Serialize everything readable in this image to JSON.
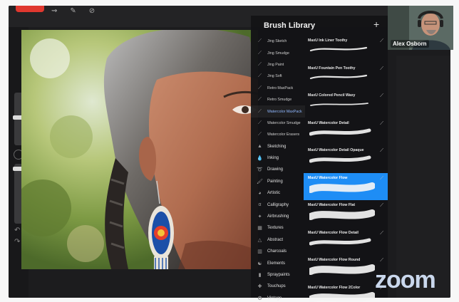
{
  "meeting": {
    "participant_name": "Alex Osborn",
    "brand": "zoom"
  },
  "app": {
    "top_tools": [
      "⇝",
      "✎",
      "⊘"
    ]
  },
  "panel": {
    "title": "Brush Library",
    "add_icon": "+",
    "sets": [
      {
        "label": "Jing Sketch",
        "icon": "brush-stroke-icon",
        "kind": "sub"
      },
      {
        "label": "Jing Smudge",
        "icon": "brush-stroke-icon",
        "kind": "sub"
      },
      {
        "label": "Jing Paint",
        "icon": "brush-stroke-icon",
        "kind": "sub"
      },
      {
        "label": "Jing Soft",
        "icon": "brush-stroke-icon",
        "kind": "sub"
      },
      {
        "label": "Retro MaxPack",
        "icon": "brush-stroke-icon",
        "kind": "sub"
      },
      {
        "label": "Retro Smudge",
        "icon": "brush-stroke-icon",
        "kind": "sub"
      },
      {
        "label": "Watercolor MaxPack",
        "icon": "brush-stroke-icon",
        "kind": "sub",
        "active": true
      },
      {
        "label": "Watercolor Smudge",
        "icon": "brush-stroke-icon",
        "kind": "sub"
      },
      {
        "label": "Watercolor Erasers",
        "icon": "brush-stroke-icon",
        "kind": "sub"
      },
      {
        "label": "Sketching",
        "icon": "pencil-icon",
        "kind": "cat"
      },
      {
        "label": "Inking",
        "icon": "ink-drop-icon",
        "kind": "cat"
      },
      {
        "label": "Drawing",
        "icon": "spiral-icon",
        "kind": "cat"
      },
      {
        "label": "Painting",
        "icon": "paint-brush-icon",
        "kind": "cat"
      },
      {
        "label": "Artistic",
        "icon": "palette-icon",
        "kind": "cat"
      },
      {
        "label": "Calligraphy",
        "icon": "calligraphy-icon",
        "kind": "cat"
      },
      {
        "label": "Airbrushing",
        "icon": "airbrush-icon",
        "kind": "cat"
      },
      {
        "label": "Textures",
        "icon": "texture-icon",
        "kind": "cat"
      },
      {
        "label": "Abstract",
        "icon": "triangle-icon",
        "kind": "cat"
      },
      {
        "label": "Charcoals",
        "icon": "charcoal-icon",
        "kind": "cat"
      },
      {
        "label": "Elements",
        "icon": "yin-yang-icon",
        "kind": "cat"
      },
      {
        "label": "Spraypaints",
        "icon": "spray-can-icon",
        "kind": "cat"
      },
      {
        "label": "Touchups",
        "icon": "touchup-icon",
        "kind": "cat"
      },
      {
        "label": "Vintage",
        "icon": "vintage-icon",
        "kind": "cat"
      }
    ],
    "brushes": [
      {
        "name": "MaxU Ink Liner Toothy",
        "stroke": "thin"
      },
      {
        "name": "MaxU Fountain Pen Toothy",
        "stroke": "thin"
      },
      {
        "name": "MaxU Colored Pencil Waxy",
        "stroke": "pencil"
      },
      {
        "name": "MaxU Watercolor Detail",
        "stroke": "medium"
      },
      {
        "name": "MaxU Watercolor Detail Opaque",
        "stroke": "medium"
      },
      {
        "name": "MaxU Watercolor Flow",
        "stroke": "wide",
        "selected": true
      },
      {
        "name": "MaxU Watercolor Flow Flat",
        "stroke": "wide"
      },
      {
        "name": "MaxU Watercolor Flow Detail",
        "stroke": "medium"
      },
      {
        "name": "MaxU Watercolor Flow Round",
        "stroke": "wide"
      },
      {
        "name": "MaxU Watercolor Flow 2Color",
        "stroke": "wide"
      }
    ]
  }
}
